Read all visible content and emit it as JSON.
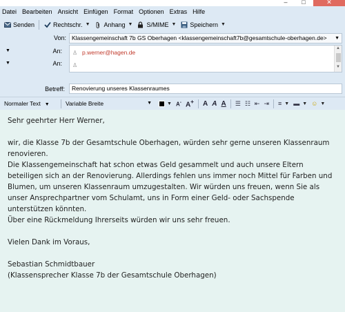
{
  "menu": [
    "Datei",
    "Bearbeiten",
    "Ansicht",
    "Einfügen",
    "Format",
    "Optionen",
    "Extras",
    "Hilfe"
  ],
  "window_controls": [
    "–",
    "□",
    "✕"
  ],
  "toolbar": {
    "send": "Senden",
    "spell": "Rechtschr.",
    "attach": "Anhang",
    "smime": "S/MIME",
    "save": "Speichern"
  },
  "header": {
    "from_label": "Von:",
    "from_value": "Klassengemeinschaft 7b GS Oberhagen <klassengemeinschaft7b@gesamtschule-oberhagen.de>",
    "to_label_1": "An:",
    "to_label_2": "An:",
    "recipient_1": "p.werner@hagen.de",
    "recipient_2": "",
    "subject_label": "Betreff:",
    "subject_value": "Renovierung unseres Klassenraumes"
  },
  "format": {
    "paragraph_style": "Normaler Text",
    "font": "Variable Breite"
  },
  "body": {
    "greeting": "Sehr geehrter Herr Werner,",
    "p1": "wir, die Klasse 7b der Gesamtschule Oberhagen, würden sehr gerne unseren Klassenraum renovieren.",
    "p2": "Die Klassengemeinschaft hat schon etwas Geld gesammelt und auch unsere Eltern beteiligen sich an der Renovierung. Allerdings fehlen uns immer noch Mittel für Farben und Blumen, um unseren Klassenraum umzugestalten. Wir würden uns freuen, wenn Sie als unser Ansprechpartner vom Schulamt, uns in Form einer Geld- oder Sachspende unterstützen könnten.",
    "p3": "Über eine Rückmeldung Ihrerseits würden wir uns sehr freuen.",
    "thanks": "Vielen Dank im Voraus,",
    "sender_name": "Sebastian Schmidtbauer",
    "sender_role": "(Klassensprecher Klasse 7b der Gesamtschule Oberhagen)"
  },
  "colors": {
    "chrome": "#dde9f4",
    "body_bg": "#e6f3f1",
    "recipient_text": "#c0392b",
    "close_button": "#e06a5f"
  }
}
